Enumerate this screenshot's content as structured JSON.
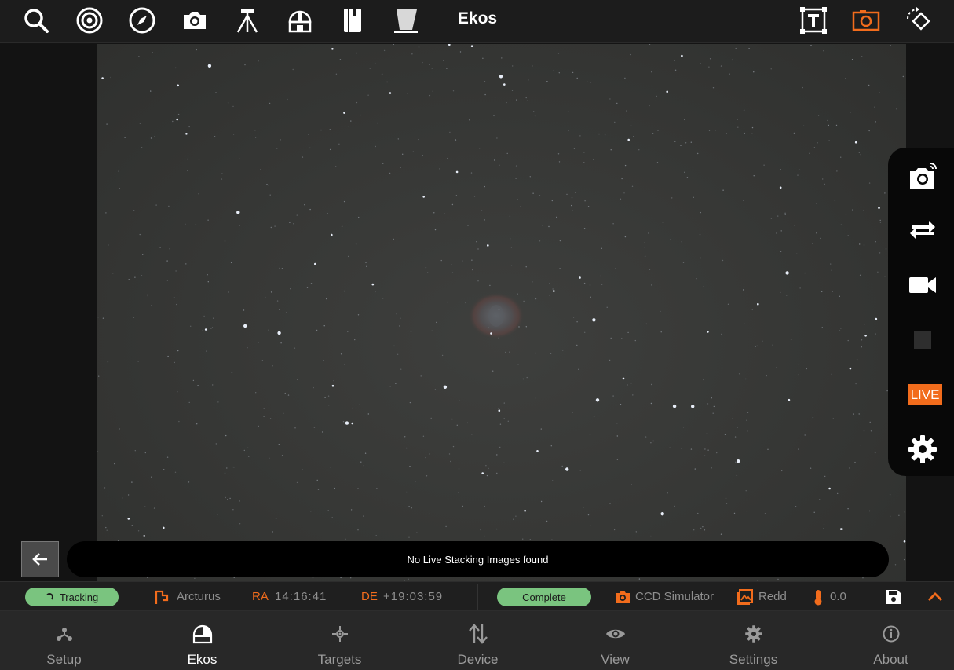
{
  "toolbar": {
    "title": "Ekos",
    "left_icons": [
      "search-icon",
      "target-icon",
      "compass-icon",
      "camera-icon",
      "tripod-icon",
      "observatory-icon",
      "notebook-icon",
      "flat-panel-icon"
    ],
    "right_icons": [
      "text-frame-icon",
      "camera-frame-icon",
      "rotate-shape-icon"
    ],
    "accent": "#f26c1c"
  },
  "capture_panel": {
    "buttons": [
      "remote-capture-icon",
      "loop-icon",
      "video-icon",
      "stop-icon",
      "live",
      "gear-icon"
    ],
    "live_label": "LIVE"
  },
  "message": "No Live Stacking Images found",
  "status": {
    "tracking_label": "Tracking",
    "target": "Arcturus",
    "ra_label": "RA",
    "ra_value": "14:16:41",
    "de_label": "DE",
    "de_value": "+19:03:59",
    "complete_label": "Complete",
    "camera": "CCD Simulator",
    "filter": "Redd",
    "temperature": "0.0",
    "pill_color": "#7ac47f"
  },
  "nav": {
    "items": [
      {
        "label": "Setup",
        "icon": "setup-icon"
      },
      {
        "label": "Ekos",
        "icon": "ekos-dome-icon"
      },
      {
        "label": "Targets",
        "icon": "targets-icon"
      },
      {
        "label": "Device",
        "icon": "device-arrows-icon"
      },
      {
        "label": "View",
        "icon": "eye-icon"
      },
      {
        "label": "Settings",
        "icon": "gear-icon"
      },
      {
        "label": "About",
        "icon": "info-icon"
      }
    ],
    "active": "Ekos"
  }
}
